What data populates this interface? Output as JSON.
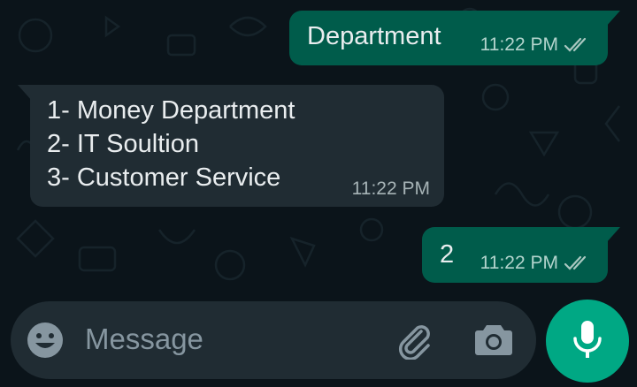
{
  "messages": [
    {
      "direction": "outgoing",
      "text": "Department",
      "time": "11:22 PM",
      "status": "read"
    },
    {
      "direction": "incoming",
      "text": "1- Money Department\n2- IT Soultion\n3- Customer Service",
      "time": "11:22 PM"
    },
    {
      "direction": "outgoing",
      "text": "2",
      "time": "11:22 PM",
      "status": "read"
    }
  ],
  "composer": {
    "placeholder": "Message",
    "icons": [
      "emoji-icon",
      "attach-icon",
      "camera-icon",
      "mic-icon"
    ]
  },
  "colors": {
    "background": "#0b141a",
    "outgoing_bubble": "#005c4b",
    "incoming_bubble": "#202c33",
    "accent": "#00a884"
  }
}
